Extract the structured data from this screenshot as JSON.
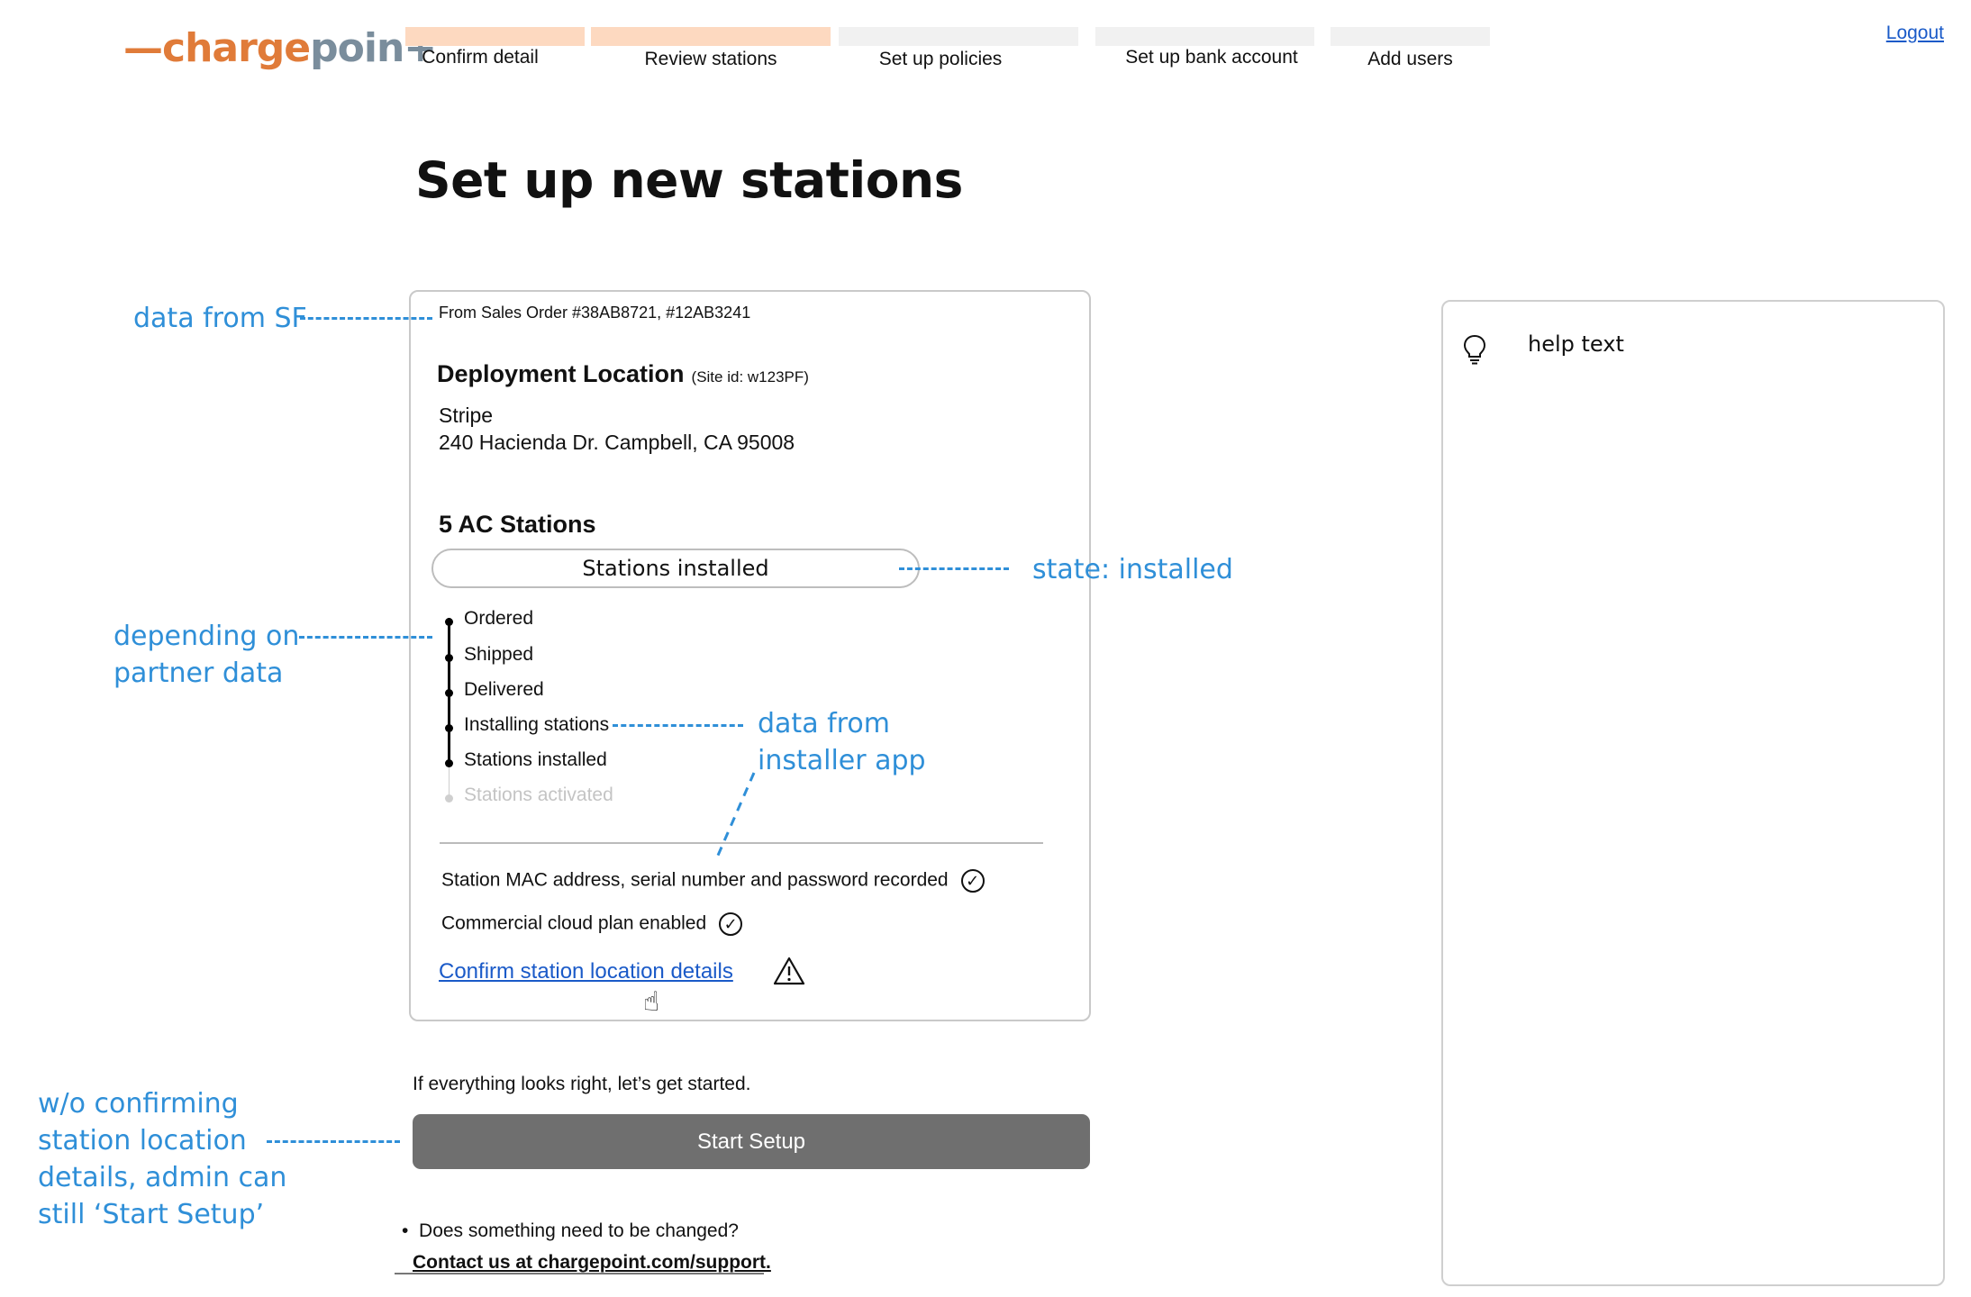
{
  "logo": {
    "part1": "chargepoin",
    "part2": "+",
    "dash": "—"
  },
  "steps": [
    {
      "label": "Confirm detail",
      "state": "done"
    },
    {
      "label": "Review stations",
      "state": "done"
    },
    {
      "label": "Set up policies",
      "state": "todo"
    },
    {
      "label": "Set up bank account",
      "state": "todo"
    },
    {
      "label": "Add users",
      "state": "todo"
    }
  ],
  "colors": {
    "step_done": "#fdd9c0",
    "step_todo": "#f1f1f1",
    "annotation": "#2f8fd8",
    "link": "#1a5ac8",
    "button": "#6f6f6f"
  },
  "header": {
    "logout": "Logout"
  },
  "page": {
    "title": "Set up new stations"
  },
  "card": {
    "sales_order": "From Sales Order #38AB8721, #12AB3241",
    "deployment_title": "Deployment Location",
    "site_id": "(Site id: w123PF)",
    "company": "Stripe",
    "address": "240 Hacienda Dr. Campbell, CA 95008",
    "stations_count": "5 AC Stations",
    "status_pill": "Stations installed",
    "timeline": [
      {
        "label": "Ordered",
        "faded": false
      },
      {
        "label": "Shipped",
        "faded": false
      },
      {
        "label": "Delivered",
        "faded": false
      },
      {
        "label": "Installing stations",
        "faded": false
      },
      {
        "label": "Stations installed",
        "faded": false
      },
      {
        "label": "Stations activated",
        "faded": true
      }
    ],
    "checks": [
      {
        "label": "Station MAC address, serial number and password recorded",
        "icon": "check-circle-icon"
      },
      {
        "label": "Commercial cloud plan enabled",
        "icon": "check-circle-icon"
      }
    ],
    "confirm_link": "Confirm station location details"
  },
  "cta": {
    "prompt": "If everything looks right, let’s get started.",
    "button": "Start Setup",
    "change_question": "Does something need to be changed?",
    "bullet": "•",
    "contact": "Contact us at chargepoint.com/support."
  },
  "help": {
    "title": "help text",
    "icon": "lightbulb-icon"
  },
  "annotations": {
    "data_from_sf": "data from SF",
    "state_installed": "state: installed",
    "partner_line1": "depending on",
    "partner_line2": "partner data",
    "installer_line1": "data from",
    "installer_line2": "installer app",
    "woc_line1": "w/o confirming",
    "woc_line2": "station location",
    "woc_line3": "details, admin can",
    "woc_line4": "still ‘Start Setup’"
  }
}
